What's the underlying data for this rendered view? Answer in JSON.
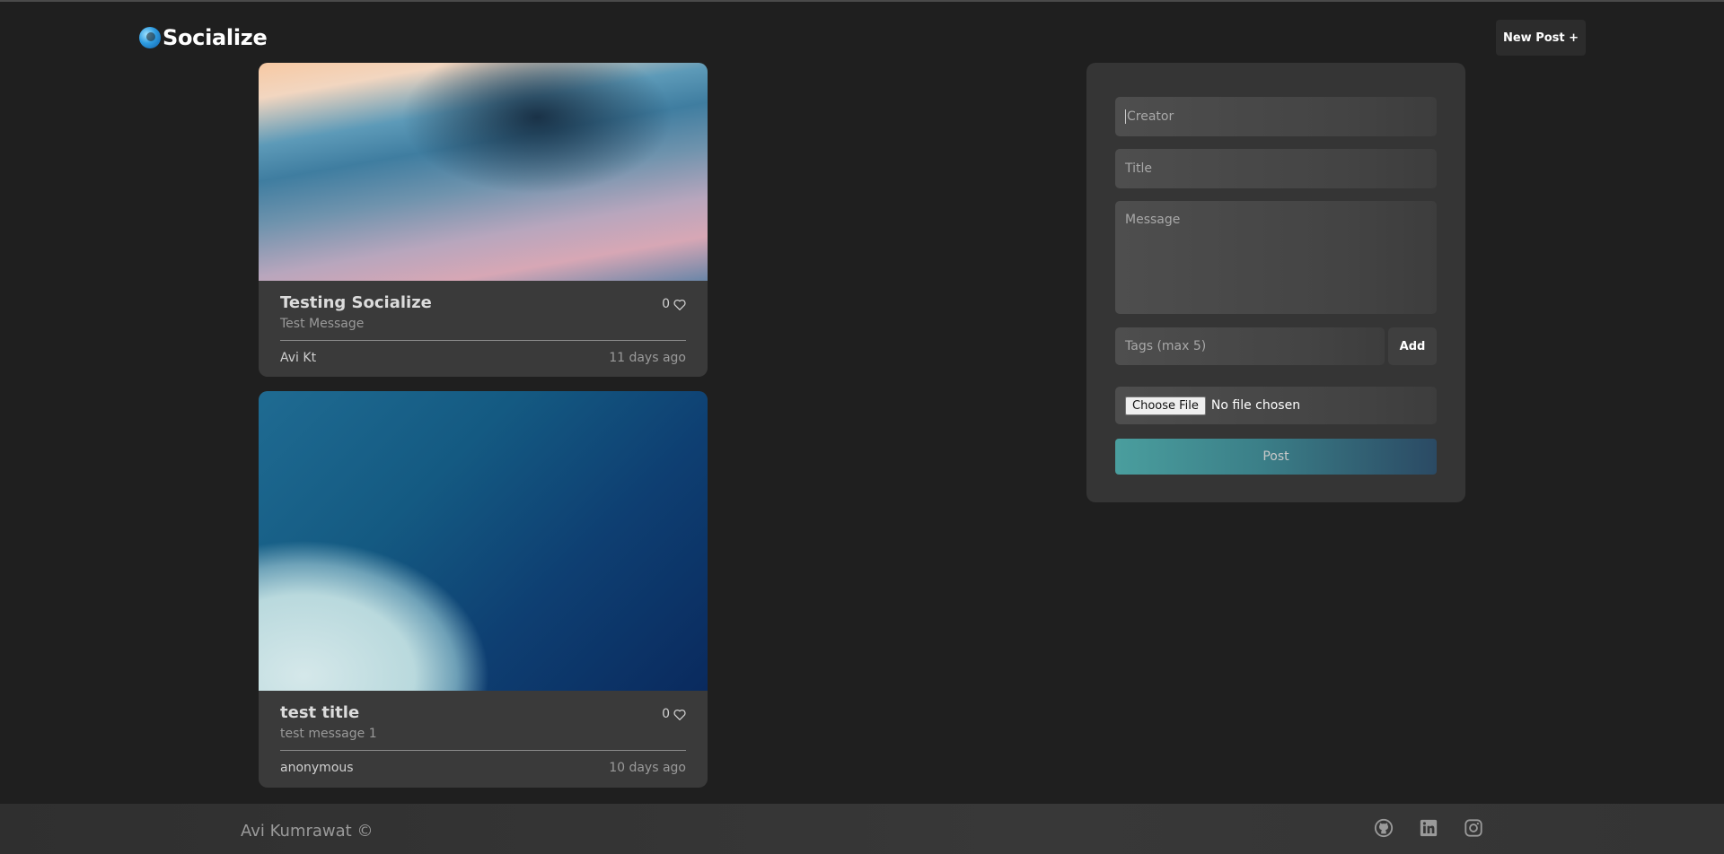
{
  "header": {
    "brand": "Socialize",
    "new_post_label": "New Post +"
  },
  "posts": [
    {
      "title": "Testing Socialize",
      "message": "Test Message",
      "likes": "0",
      "creator": "Avi Kt",
      "time": "11 days ago"
    },
    {
      "title": "test title",
      "message": "test message 1",
      "likes": "0",
      "creator": "anonymous",
      "time": "10 days ago"
    }
  ],
  "form": {
    "creator_placeholder": "Creator",
    "title_placeholder": "Title",
    "message_placeholder": "Message",
    "tags_placeholder": "Tags (max 5)",
    "add_label": "Add",
    "choose_file_label": "Choose File",
    "file_status": "No file chosen",
    "post_label": "Post"
  },
  "footer": {
    "text": "Avi Kumrawat ©",
    "icons": [
      "github-icon",
      "linkedin-icon",
      "instagram-icon"
    ]
  }
}
